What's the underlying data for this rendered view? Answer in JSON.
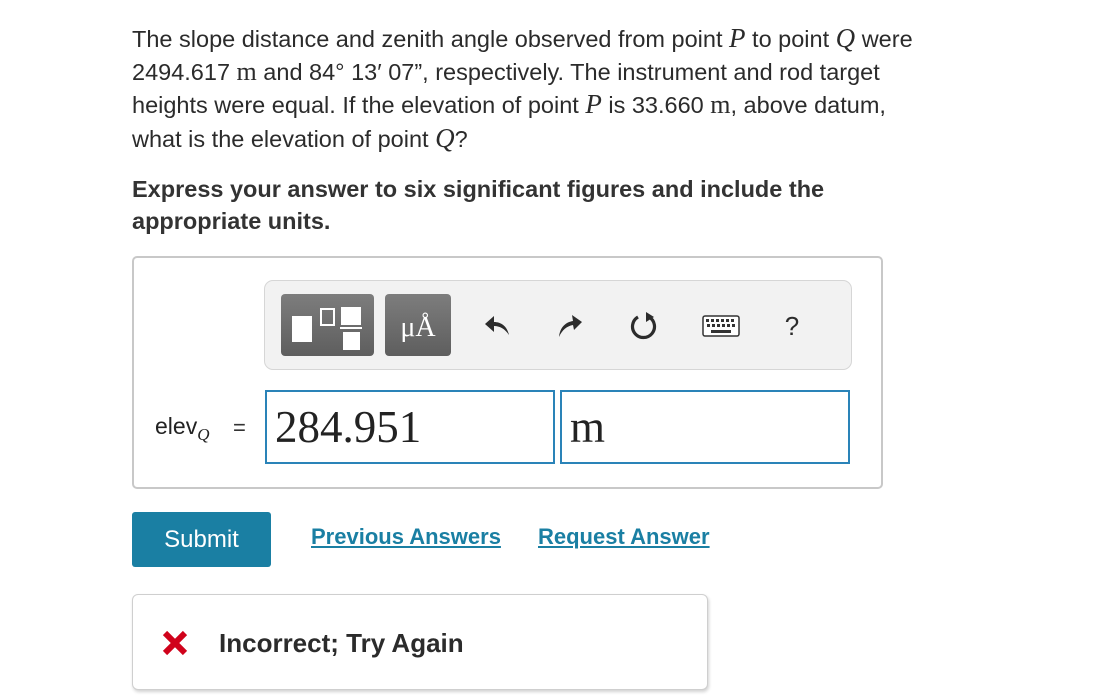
{
  "question": {
    "s1": "The slope distance and zenith angle observed from point ",
    "var_p": "P",
    "s2": " to point ",
    "var_q": "Q",
    "s3": " were",
    "s4": "2494.617 ",
    "unit_m": "m",
    "s5": " and 84° 13′ 07”, respectively. The instrument and rod target",
    "s6": "heights were equal. If the elevation of point ",
    "s7": " is 33.660 ",
    "s8": ", above datum,",
    "s9": "what is the elevation of point ",
    "s10": "?"
  },
  "instructions": {
    "line1": "Express your answer to six significant figures and include the",
    "line2": "appropriate units."
  },
  "toolbar": {
    "units_label": "μÅ",
    "help_label": "?",
    "icons": [
      "templates-icon",
      "units-icon",
      "undo-icon",
      "redo-icon",
      "reset-icon",
      "keyboard-icon",
      "help-icon"
    ]
  },
  "answer": {
    "label": "elev",
    "label_sub": "Q",
    "equals": "=",
    "value": "284.951",
    "unit": "m"
  },
  "actions": {
    "submit": "Submit",
    "previous_answers": "Previous Answers",
    "request_answer": "Request Answer"
  },
  "feedback": {
    "text": "Incorrect; Try Again"
  },
  "colors": {
    "accent": "#1a7fa3",
    "input_border": "#2a83b8",
    "error": "#d0021b"
  }
}
